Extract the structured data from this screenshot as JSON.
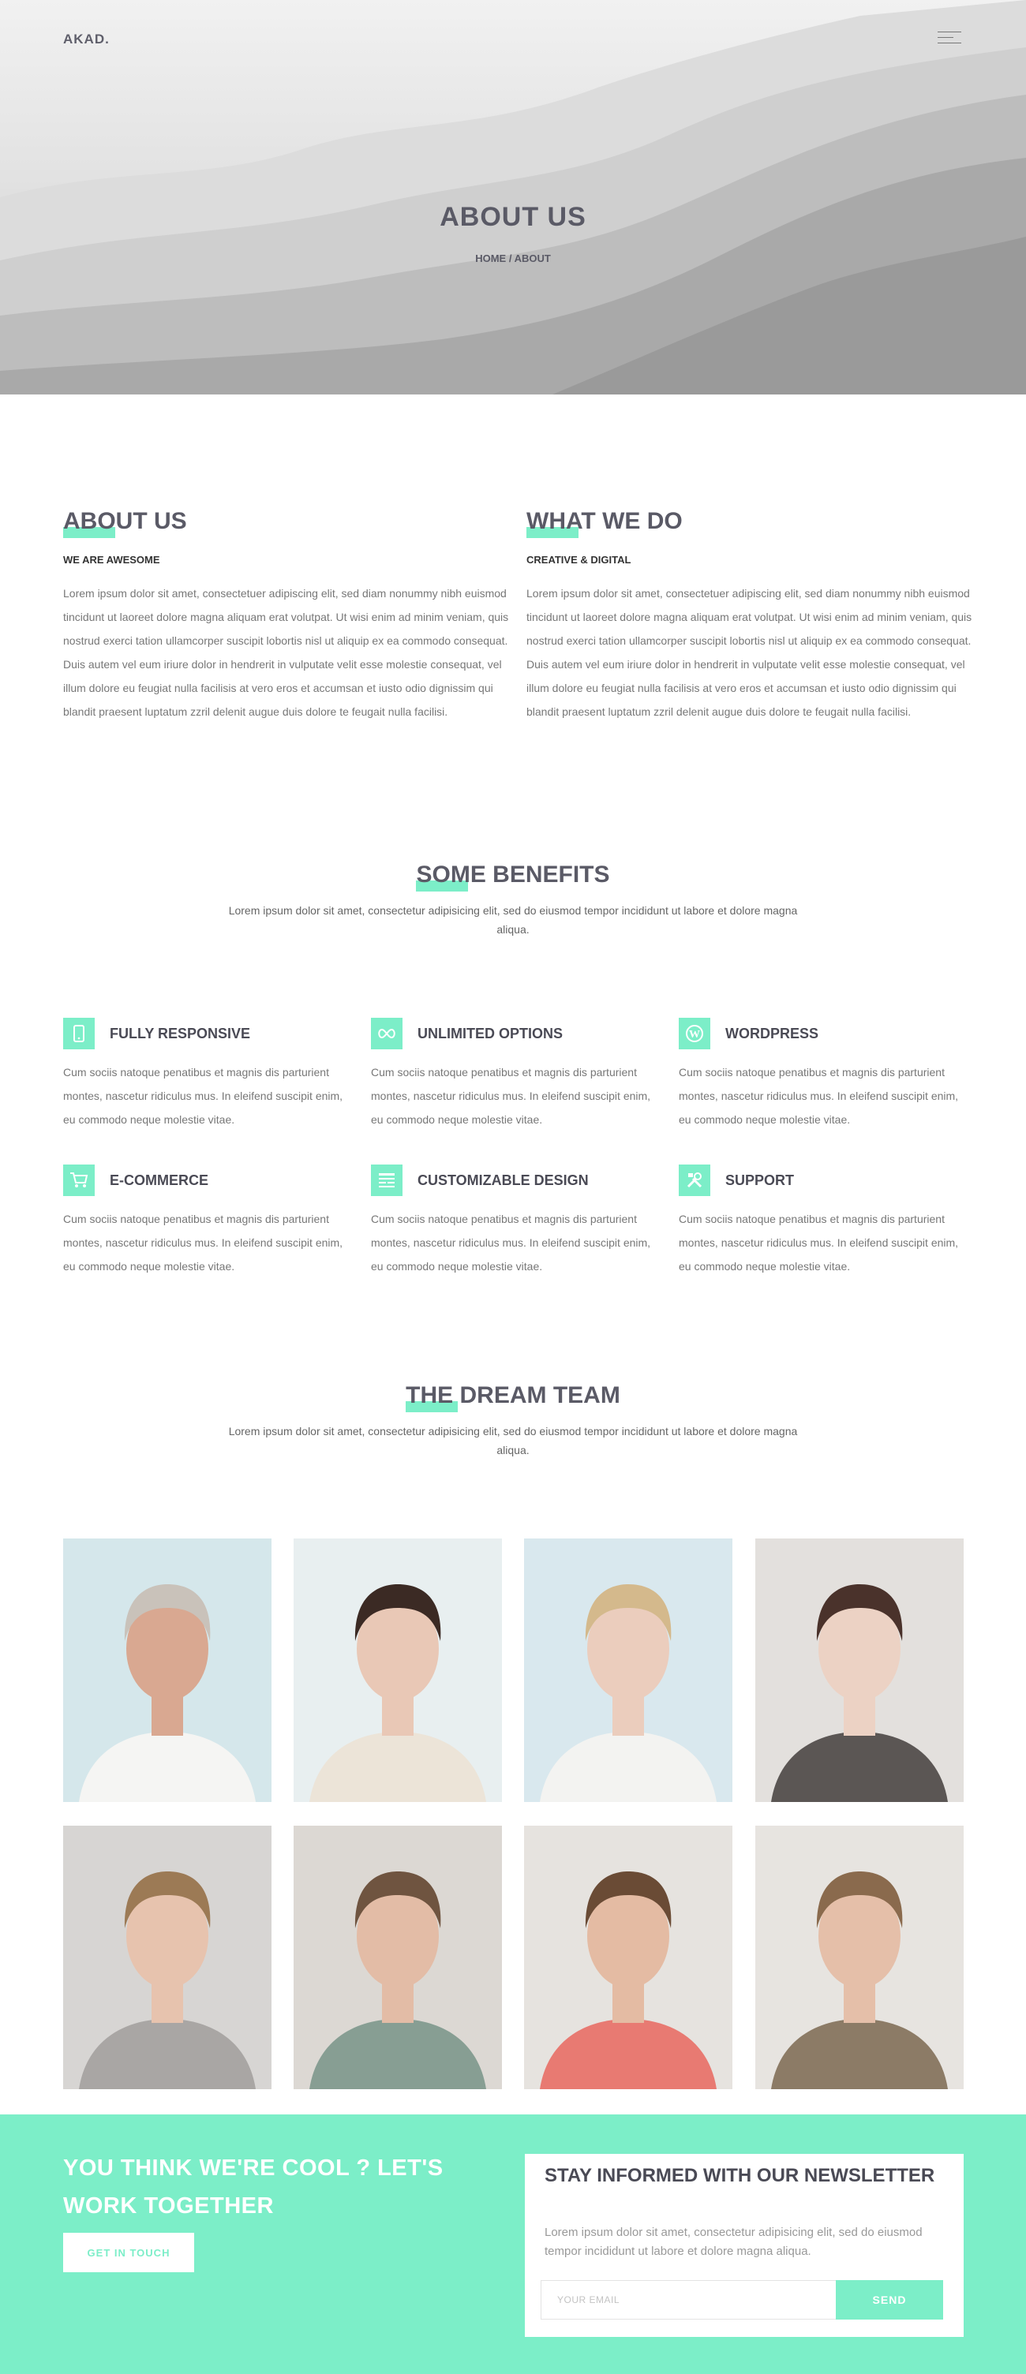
{
  "brand": {
    "logo": "AKAD.",
    "accent": "#7ceec8"
  },
  "header": {
    "menu_icon": "hamburger-menu-icon"
  },
  "hero": {
    "title": "ABOUT US",
    "breadcrumb": {
      "home": "HOME",
      "separator": "/",
      "current": "ABOUT"
    }
  },
  "about": {
    "left": {
      "title": "ABOUT US",
      "subtitle": "WE ARE AWESOME",
      "text": "Lorem ipsum dolor sit amet, consectetuer adipiscing elit, sed diam nonummy nibh euismod tincidunt ut laoreet dolore magna aliquam erat volutpat. Ut wisi enim ad minim veniam, quis nostrud exerci tation ullamcorper suscipit lobortis nisl ut aliquip ex ea commodo consequat. Duis autem vel eum iriure dolor in hendrerit in vulputate velit esse molestie consequat, vel illum dolore eu feugiat nulla facilisis at vero eros et accumsan et iusto odio dignissim qui blandit praesent luptatum zzril delenit augue duis dolore te feugait nulla facilisi."
    },
    "right": {
      "title": "WHAT WE DO",
      "subtitle": "CREATIVE & DIGITAL",
      "text": "Lorem ipsum dolor sit amet, consectetuer adipiscing elit, sed diam nonummy nibh euismod tincidunt ut laoreet dolore magna aliquam erat volutpat. Ut wisi enim ad minim veniam, quis nostrud exerci tation ullamcorper suscipit lobortis nisl ut aliquip ex ea commodo consequat. Duis autem vel eum iriure dolor in hendrerit in vulputate velit esse molestie consequat, vel illum dolore eu feugiat nulla facilisis at vero eros et accumsan et iusto odio dignissim qui blandit praesent luptatum zzril delenit augue duis dolore te feugait nulla facilisi."
    }
  },
  "benefits": {
    "title": "SOME BENEFITS",
    "intro": "Lorem ipsum dolor sit amet, consectetur adipisicing elit, sed do eiusmod tempor incididunt ut labore et dolore magna aliqua.",
    "items": [
      {
        "icon": "mobile-phone-icon",
        "title": "FULLY RESPONSIVE",
        "text": "Cum sociis natoque penatibus et magnis dis parturient montes, nascetur ridiculus mus. In eleifend suscipit enim, eu commodo neque molestie vitae."
      },
      {
        "icon": "infinity-icon",
        "title": "UNLIMITED OPTIONS",
        "text": "Cum sociis natoque penatibus et magnis dis parturient montes, nascetur ridiculus mus. In eleifend suscipit enim, eu commodo neque molestie vitae."
      },
      {
        "icon": "wordpress-icon",
        "title": "WORDPRESS",
        "text": "Cum sociis natoque penatibus et magnis dis parturient montes, nascetur ridiculus mus. In eleifend suscipit enim, eu commodo neque molestie vitae."
      },
      {
        "icon": "shopping-cart-icon",
        "title": "E-COMMERCE",
        "text": "Cum sociis natoque penatibus et magnis dis parturient montes, nascetur ridiculus mus. In eleifend suscipit enim, eu commodo neque molestie vitae."
      },
      {
        "icon": "layout-design-icon",
        "title": "CUSTOMIZABLE DESIGN",
        "text": "Cum sociis natoque penatibus et magnis dis parturient montes, nascetur ridiculus mus. In eleifend suscipit enim, eu commodo neque molestie vitae."
      },
      {
        "icon": "tools-icon",
        "title": "SUPPORT",
        "text": "Cum sociis natoque penatibus et magnis dis parturient montes, nascetur ridiculus mus. In eleifend suscipit enim, eu commodo neque molestie vitae."
      }
    ]
  },
  "team": {
    "title": "THE DREAM TEAM",
    "intro": "Lorem ipsum dolor sit amet, consectetur adipisicing elit, sed do eiusmod tempor incididunt ut labore et dolore magna aliqua.",
    "photos": [
      {
        "bg": "#d5e7eb",
        "hair": "#c9c2ba",
        "skin": "#d9a891",
        "shirt": "#f5f5f3"
      },
      {
        "bg": "#e8eff0",
        "hair": "#3b2a24",
        "skin": "#e9c8b6",
        "shirt": "#ece4d8"
      },
      {
        "bg": "#d9e8ee",
        "hair": "#d4b98c",
        "skin": "#ebcdbd",
        "shirt": "#f3f3f1"
      },
      {
        "bg": "#e3e0dd",
        "hair": "#4a322b",
        "skin": "#ecd2c4",
        "shirt": "#5b5654"
      },
      {
        "bg": "#d7d5d3",
        "hair": "#9c7a55",
        "skin": "#e7c3ae",
        "shirt": "#a9a6a4"
      },
      {
        "bg": "#dcd8d3",
        "hair": "#6f5440",
        "skin": "#e3bca6",
        "shirt": "#879e93"
      },
      {
        "bg": "#e6e3df",
        "hair": "#6a4b35",
        "skin": "#e4bba3",
        "shirt": "#e87a72"
      },
      {
        "bg": "#e7e4e0",
        "hair": "#8a6a4d",
        "skin": "#e5bfa9",
        "shirt": "#8c7b66"
      }
    ]
  },
  "cta": {
    "title": "YOU THINK WE'RE COOL ? LET'S WORK TOGETHER",
    "button": "GET IN TOUCH"
  },
  "newsletter": {
    "title": "STAY INFORMED WITH OUR NEWSLETTER",
    "text": "Lorem ipsum dolor sit amet, consectetur adipisicing elit, sed do eiusmod tempor incididunt ut labore et dolore magna aliqua.",
    "placeholder": "YOUR EMAIL",
    "button": "SEND"
  }
}
